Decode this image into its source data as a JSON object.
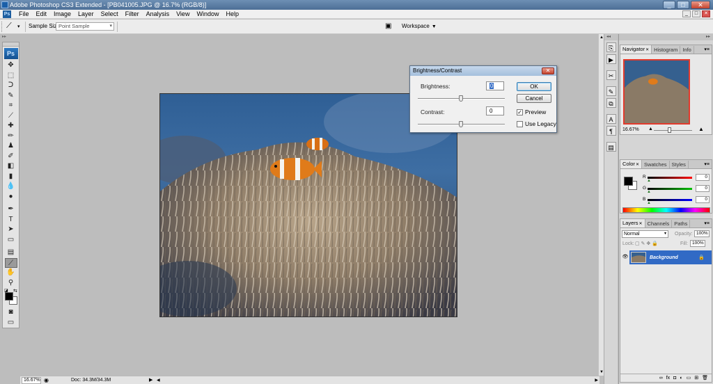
{
  "window": {
    "title": "Adobe Photoshop CS3 Extended - [PB041005.JPG @ 16.7% (RGB/8)]",
    "controls": [
      "_",
      "□",
      "✕"
    ]
  },
  "menu": {
    "items": [
      "File",
      "Edit",
      "Image",
      "Layer",
      "Select",
      "Filter",
      "Analysis",
      "View",
      "Window",
      "Help"
    ],
    "doc_controls": [
      "_",
      "□",
      "✕"
    ]
  },
  "options": {
    "sample_size_label": "Sample Size:",
    "sample_size_value": "Point Sample",
    "workspace_label": "Workspace"
  },
  "toolbox": {
    "logo": "Ps",
    "tools": [
      {
        "name": "move",
        "glyph": "✥"
      },
      {
        "name": "marquee",
        "glyph": "⬚"
      },
      {
        "name": "lasso",
        "glyph": "ᑐ"
      },
      {
        "name": "quick-selection",
        "glyph": "✎"
      },
      {
        "name": "crop",
        "glyph": "⌗"
      },
      {
        "name": "slice",
        "glyph": "⟋"
      },
      {
        "name": "healing",
        "glyph": "✚"
      },
      {
        "name": "brush",
        "glyph": "✏"
      },
      {
        "name": "clone-stamp",
        "glyph": "♟"
      },
      {
        "name": "history-brush",
        "glyph": "✐"
      },
      {
        "name": "eraser",
        "glyph": "◧"
      },
      {
        "name": "gradient",
        "glyph": "▮"
      },
      {
        "name": "blur",
        "glyph": "💧"
      },
      {
        "name": "dodge",
        "glyph": "●"
      },
      {
        "name": "pen",
        "glyph": "✒"
      },
      {
        "name": "type",
        "glyph": "T"
      },
      {
        "name": "path-selection",
        "glyph": "➤"
      },
      {
        "name": "shape",
        "glyph": "▭"
      },
      {
        "name": "notes",
        "glyph": "▤"
      },
      {
        "name": "eyedropper",
        "glyph": "⟋"
      },
      {
        "name": "hand",
        "glyph": "✋"
      },
      {
        "name": "zoom",
        "glyph": "⚲"
      }
    ],
    "active_tool": "eyedropper"
  },
  "document": {
    "zoom": "16.67%",
    "doc_info": "Doc: 34.3M/34.3M"
  },
  "dialog": {
    "title": "Brightness/Contrast",
    "brightness_label": "Brightness:",
    "brightness_value": "0",
    "contrast_label": "Contrast:",
    "contrast_value": "0",
    "ok_label": "OK",
    "cancel_label": "Cancel",
    "preview_label": "Preview",
    "preview_checked": true,
    "legacy_label": "Use Legacy",
    "legacy_checked": false
  },
  "navigator_panel": {
    "tabs": [
      "Navigator",
      "Histogram",
      "Info"
    ],
    "zoom": "16.67%"
  },
  "color_panel": {
    "tabs": [
      "Color",
      "Swatches",
      "Styles"
    ],
    "channels": [
      {
        "label": "R",
        "value": "0",
        "color": "#ff0000"
      },
      {
        "label": "G",
        "value": "0",
        "color": "#00c000"
      },
      {
        "label": "B",
        "value": "0",
        "color": "#0000ff"
      }
    ]
  },
  "layers_panel": {
    "tabs": [
      "Layers",
      "Channels",
      "Paths"
    ],
    "blend_mode": "Normal",
    "opacity_label": "Opacity:",
    "opacity_value": "100%",
    "lock_label": "Lock:",
    "fill_label": "Fill:",
    "fill_value": "100%",
    "layer_name": "Background"
  }
}
